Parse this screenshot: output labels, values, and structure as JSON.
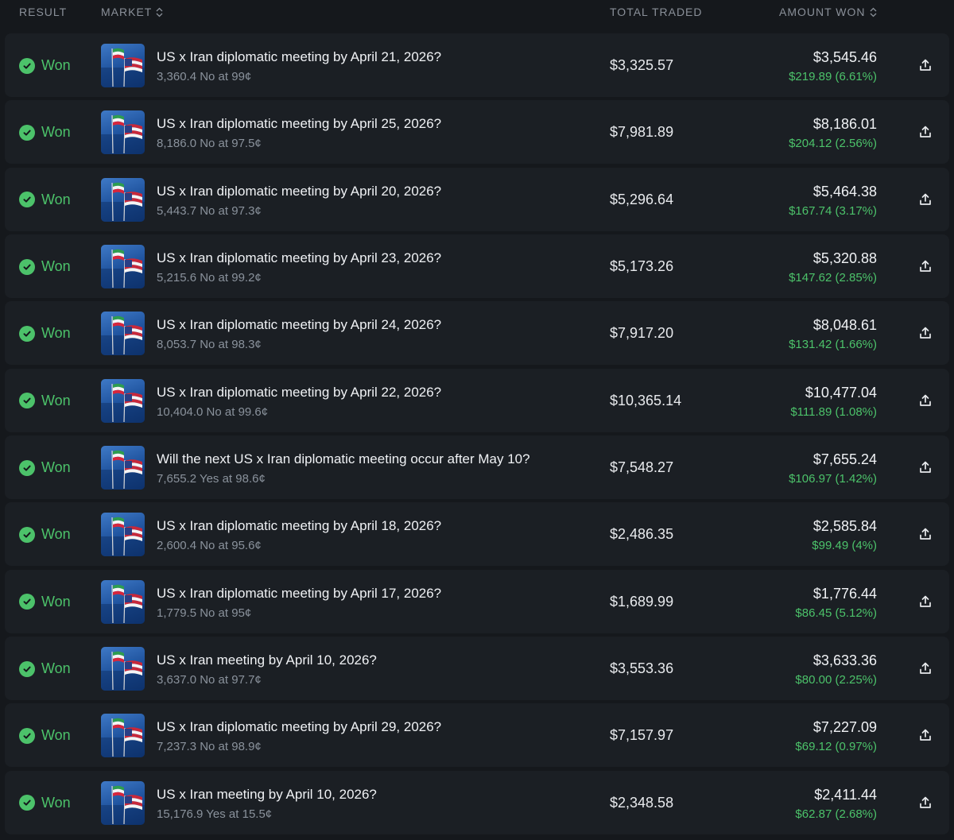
{
  "header": {
    "result": "RESULT",
    "market": "MARKET",
    "total_traded": "TOTAL TRADED",
    "amount_won": "AMOUNT WON"
  },
  "colors": {
    "background": "#15181c",
    "row": "#1b1f24",
    "won": "#4cc26a",
    "muted": "#8a929c"
  },
  "icons": {
    "result": "check-circle-icon",
    "sort": "sort-icon",
    "share": "share-icon"
  },
  "rows": [
    {
      "result": "Won",
      "title": "US x Iran diplomatic meeting by April 21, 2026?",
      "position": "3,360.4 No at 99¢",
      "traded": "$3,325.57",
      "won": "$3,545.46",
      "gain": "$219.89 (6.61%)"
    },
    {
      "result": "Won",
      "title": "US x Iran diplomatic meeting by April 25, 2026?",
      "position": "8,186.0 No at 97.5¢",
      "traded": "$7,981.89",
      "won": "$8,186.01",
      "gain": "$204.12 (2.56%)"
    },
    {
      "result": "Won",
      "title": "US x Iran diplomatic meeting by April 20, 2026?",
      "position": "5,443.7 No at 97.3¢",
      "traded": "$5,296.64",
      "won": "$5,464.38",
      "gain": "$167.74 (3.17%)"
    },
    {
      "result": "Won",
      "title": "US x Iran diplomatic meeting by April 23, 2026?",
      "position": "5,215.6 No at 99.2¢",
      "traded": "$5,173.26",
      "won": "$5,320.88",
      "gain": "$147.62 (2.85%)"
    },
    {
      "result": "Won",
      "title": "US x Iran diplomatic meeting by April 24, 2026?",
      "position": "8,053.7 No at 98.3¢",
      "traded": "$7,917.20",
      "won": "$8,048.61",
      "gain": "$131.42 (1.66%)"
    },
    {
      "result": "Won",
      "title": "US x Iran diplomatic meeting by April 22, 2026?",
      "position": "10,404.0 No at 99.6¢",
      "traded": "$10,365.14",
      "won": "$10,477.04",
      "gain": "$111.89 (1.08%)"
    },
    {
      "result": "Won",
      "title": "Will the next US x Iran diplomatic meeting occur after May 10?",
      "position": "7,655.2 Yes at 98.6¢",
      "traded": "$7,548.27",
      "won": "$7,655.24",
      "gain": "$106.97 (1.42%)"
    },
    {
      "result": "Won",
      "title": "US x Iran diplomatic meeting by April 18, 2026?",
      "position": "2,600.4 No at 95.6¢",
      "traded": "$2,486.35",
      "won": "$2,585.84",
      "gain": "$99.49 (4%)"
    },
    {
      "result": "Won",
      "title": "US x Iran diplomatic meeting by April 17, 2026?",
      "position": "1,779.5 No at 95¢",
      "traded": "$1,689.99",
      "won": "$1,776.44",
      "gain": "$86.45 (5.12%)"
    },
    {
      "result": "Won",
      "title": "US x Iran meeting by April 10, 2026?",
      "position": "3,637.0 No at 97.7¢",
      "traded": "$3,553.36",
      "won": "$3,633.36",
      "gain": "$80.00 (2.25%)"
    },
    {
      "result": "Won",
      "title": "US x Iran diplomatic meeting by April 29, 2026?",
      "position": "7,237.3 No at 98.9¢",
      "traded": "$7,157.97",
      "won": "$7,227.09",
      "gain": "$69.12 (0.97%)"
    },
    {
      "result": "Won",
      "title": "US x Iran meeting by April 10, 2026?",
      "position": "15,176.9 Yes at 15.5¢",
      "traded": "$2,348.58",
      "won": "$2,411.44",
      "gain": "$62.87 (2.68%)"
    }
  ]
}
